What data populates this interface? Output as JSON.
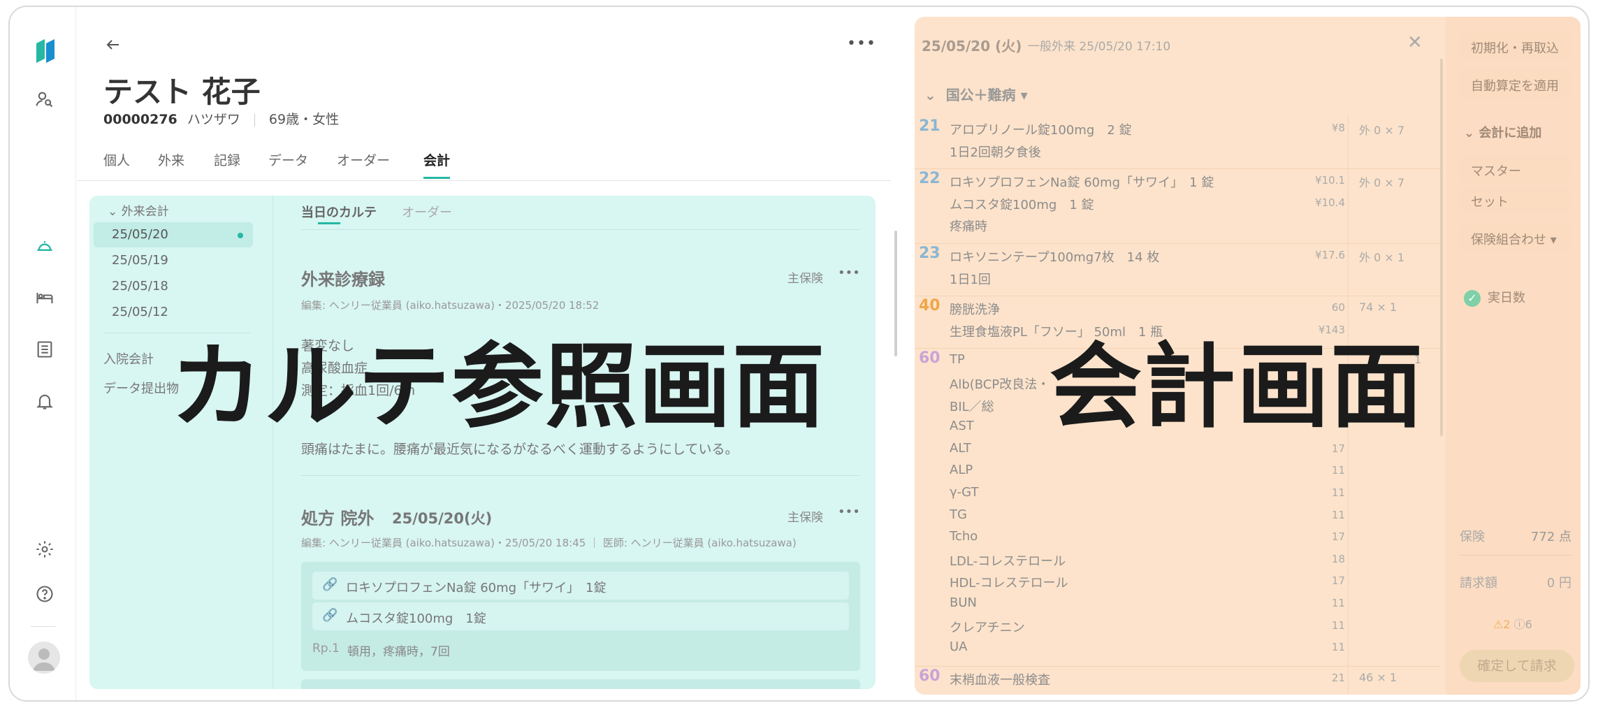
{
  "patient": {
    "name": "テスト 花子",
    "id": "00000276",
    "kana": "ハツザワ",
    "age_sex": "69歳・女性"
  },
  "tabs": [
    "個人",
    "外来",
    "記録",
    "データ",
    "オーダー",
    "会計"
  ],
  "sidebar": {
    "group": "外来会計",
    "dates": [
      "25/05/20",
      "25/05/19",
      "25/05/18",
      "25/05/12"
    ],
    "inpatient": "入院会計",
    "data_submit": "データ提出物"
  },
  "karte_tabs": [
    "当日のカルテ",
    "オーダー"
  ],
  "record1": {
    "title": "外来診療録",
    "badge": "主保険",
    "meta": "編集: ヘンリー従業員 (aiko.hatsuzawa)・2025/05/20 18:52",
    "line1": "著変なし",
    "line2": "高尿酸血症",
    "line3": "測定：採血1回/6m",
    "line4": "頭痛はたまに。腰痛が最近気になるがなるべく運動するようにしている。"
  },
  "record2": {
    "title": "処方 院外",
    "date": "25/05/20(火)",
    "badge": "主保険",
    "meta": "編集: ヘンリー従業員 (aiko.hatsuzawa)・25/05/20 18:45 ｜ 医師: ヘンリー従業員 (aiko.hatsuzawa)",
    "drug1": "ロキソプロフェンNa錠 60mg「サワイ」　1錠",
    "drug2": "ムコスタ錠100mg　1錠",
    "rp": "Rp.1",
    "rp_detail": "頓用，疼痛時，7回"
  },
  "billing": {
    "date": "25/05/20 (火)",
    "visit": "一般外来 25/05/20 17:10",
    "insurance_group": "国公＋難病",
    "items": [
      {
        "code": "21",
        "lines": [
          "アロプリノール錠100mg　2 錠",
          "1日2回朝夕食後"
        ],
        "prices": [
          "¥8",
          ""
        ],
        "qty": "外 0 × 7"
      },
      {
        "code": "22",
        "lines": [
          "ロキソプロフェンNa錠 60mg「サワイ」　1 錠",
          "ムコスタ錠100mg　1 錠",
          "疼痛時"
        ],
        "prices": [
          "¥10.1",
          "¥10.4",
          ""
        ],
        "qty": "外 0 × 7"
      },
      {
        "code": "23",
        "lines": [
          "ロキソニンテープ100mg7枚　14 枚",
          "1日1回"
        ],
        "prices": [
          "¥17.6",
          ""
        ],
        "qty": "外 0 × 1"
      },
      {
        "code": "40",
        "lines": [
          "膀胱洗浄",
          "生理食塩液PL「フソー」 50ml　1 瓶"
        ],
        "prices": [
          "60",
          "¥143"
        ],
        "qty": "74 × 1"
      },
      {
        "code": "60",
        "lines": [
          "TP",
          "Alb(BCP改良法・",
          "BIL／総",
          "AST",
          "ALT",
          "ALP",
          "γ-GT",
          "TG",
          "Tcho",
          "LDL-コレステロール",
          "HDL-コレステロール",
          "BUN",
          "クレアチニン",
          "UA"
        ],
        "prices": [
          "",
          "",
          "",
          "",
          "17",
          "11",
          "11",
          "11",
          "17",
          "18",
          "17",
          "11",
          "11",
          "11"
        ],
        "qty": "1"
      },
      {
        "code": "60",
        "lines": [
          "末梢血液一般検査"
        ],
        "prices": [
          "21"
        ],
        "qty": "46 × 1"
      }
    ],
    "buttons": {
      "reset": "初期化・再取込",
      "auto": "自動算定を適用",
      "add": "会計に追加",
      "master": "マスター",
      "set": "セット",
      "insurance_combo": "保険組合わせ",
      "days": "実日数",
      "confirm": "確定して請求"
    },
    "summary": {
      "insurance_label": "保険",
      "insurance_value": "772 点",
      "bill_label": "請求額",
      "bill_value": "0 円",
      "warn": "2",
      "info": "6"
    }
  },
  "overlay": {
    "left": "カルテ参照画面",
    "right": "会計画面"
  },
  "colors": {
    "teal": "#26b8a3",
    "overlay_cyan": "#d8f6f2",
    "overlay_orange": "#fde3cb",
    "code_blue": "#8ab6d3",
    "code_orange": "#f0a64a",
    "code_purple": "#c9a4d8"
  }
}
